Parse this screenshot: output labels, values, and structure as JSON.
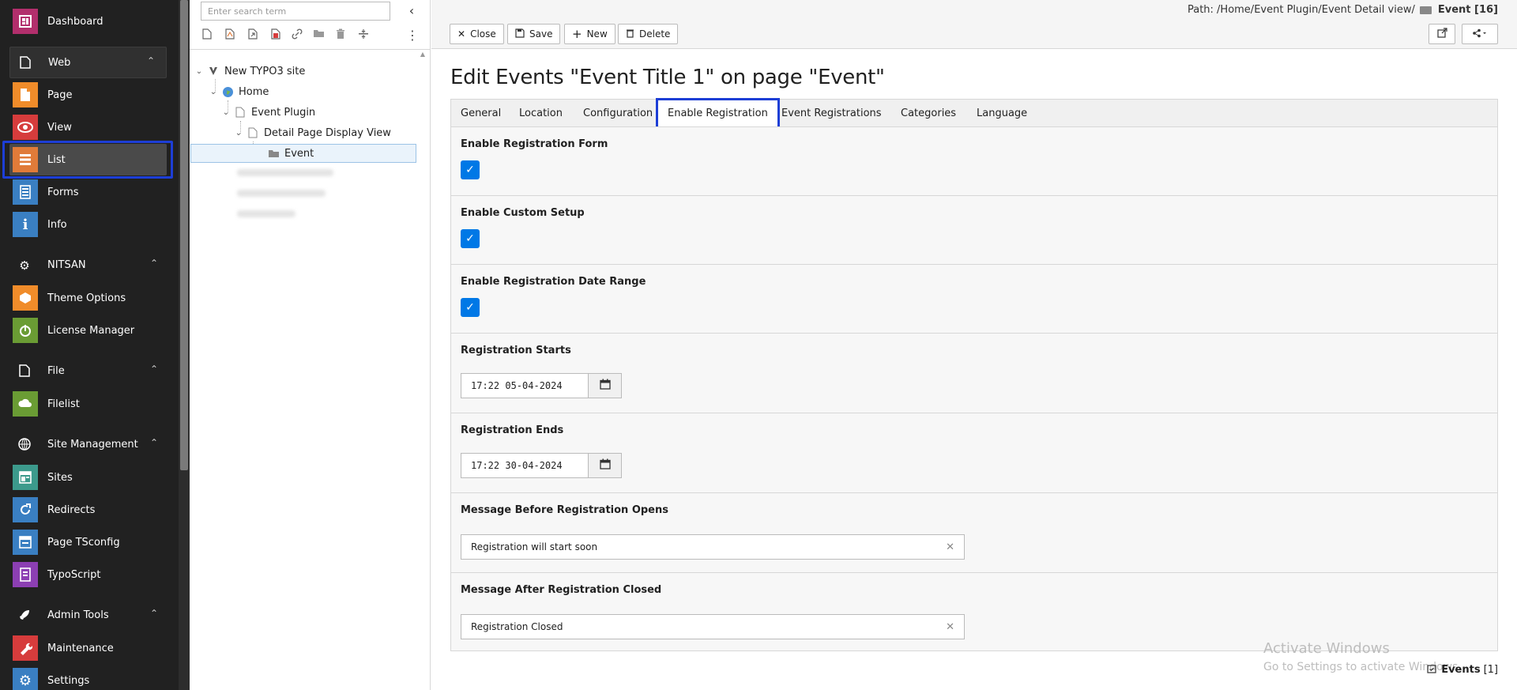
{
  "module_menu": {
    "items": [
      {
        "id": "dashboard",
        "label": "Dashboard",
        "icon": "dashboard-icon",
        "color": "#b22f6c"
      },
      {
        "id": "page",
        "label": "Page",
        "icon": "page-icon",
        "color": "#f08c2a"
      },
      {
        "id": "view",
        "label": "View",
        "icon": "eye-icon",
        "color": "#d63c3c"
      },
      {
        "id": "list",
        "label": "List",
        "icon": "list-icon",
        "color": "#e07b39"
      },
      {
        "id": "forms",
        "label": "Forms",
        "icon": "forms-icon",
        "color": "#3a7fc2"
      },
      {
        "id": "info",
        "label": "Info",
        "icon": "info-icon",
        "color": "#3a7fc2"
      },
      {
        "id": "theme",
        "label": "Theme Options",
        "icon": "theme-icon",
        "color": "#f08c2a"
      },
      {
        "id": "license",
        "label": "License Manager",
        "icon": "power-icon",
        "color": "#6a9c34"
      },
      {
        "id": "filelist",
        "label": "Filelist",
        "icon": "filelist-icon",
        "color": "#6a9c34"
      },
      {
        "id": "sites",
        "label": "Sites",
        "icon": "sites-icon",
        "color": "#3c9a8c"
      },
      {
        "id": "redirects",
        "label": "Redirects",
        "icon": "redirect-icon",
        "color": "#3a7fc2"
      },
      {
        "id": "tsconfig",
        "label": "Page TSconfig",
        "icon": "tsconfig-icon",
        "color": "#3a7fc2"
      },
      {
        "id": "typoscript",
        "label": "TypoScript",
        "icon": "typoscript-icon",
        "color": "#8c3fb3"
      },
      {
        "id": "maintenance",
        "label": "Maintenance",
        "icon": "wrench-icon",
        "color": "#d63c3c"
      },
      {
        "id": "settings",
        "label": "Settings",
        "icon": "gear-icon",
        "color": "#3a7fc2"
      }
    ],
    "groups": {
      "web": "Web",
      "nitsan": "NITSAN",
      "file": "File",
      "site_management": "Site Management",
      "admin_tools": "Admin Tools"
    }
  },
  "tree": {
    "search_placeholder": "Enter search term",
    "nodes": {
      "root": "New TYPO3 site",
      "home": "Home",
      "event_plugin": "Event Plugin",
      "detail_page": "Detail Page Display View",
      "event": "Event"
    }
  },
  "doc_header": {
    "close": "Close",
    "save": "Save",
    "new": "New",
    "delete": "Delete",
    "path_label": "Path: /Home/Event Plugin/Event Detail view/",
    "path_record": "Event [16]"
  },
  "main": {
    "title": "Edit Events \"Event Title 1\" on page \"Event\"",
    "tabs": [
      "General",
      "Location",
      "Configuration",
      "Enable Registration",
      "Event Registrations",
      "Categories",
      "Language"
    ],
    "active_tab": "Enable Registration",
    "fields": {
      "enable_form": {
        "label": "Enable Registration Form",
        "checked": true
      },
      "enable_custom": {
        "label": "Enable Custom Setup",
        "checked": true
      },
      "enable_range": {
        "label": "Enable Registration Date Range",
        "checked": true
      },
      "reg_starts": {
        "label": "Registration Starts",
        "value": "17:22 05-04-2024"
      },
      "reg_ends": {
        "label": "Registration Ends",
        "value": "17:22 30-04-2024"
      },
      "msg_before": {
        "label": "Message Before Registration Opens",
        "value": "Registration will start soon"
      },
      "msg_after": {
        "label": "Message After Registration Closed",
        "value": "Registration Closed"
      }
    }
  },
  "footer": {
    "events_label": "Events",
    "events_count": "[1]"
  },
  "watermark": {
    "line1": "Activate Windows",
    "line2": "Go to Settings to activate Windows."
  },
  "colors": {
    "accent": "#1d3ed6",
    "checkbox": "#0078e6",
    "menu_bg": "#212121"
  }
}
